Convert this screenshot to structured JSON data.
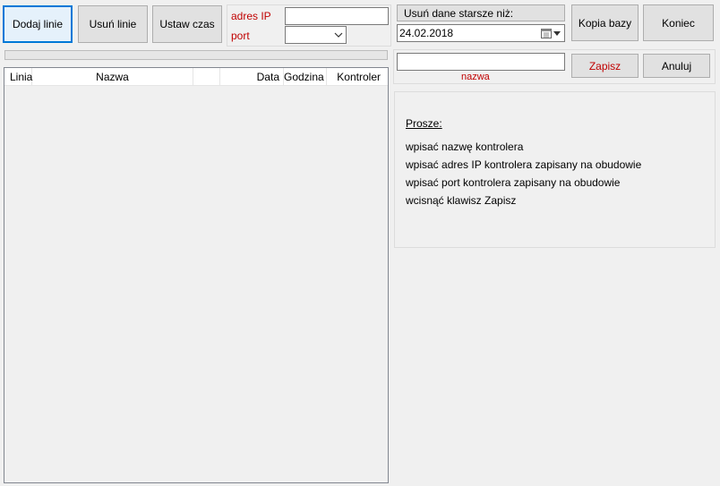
{
  "toolbar": {
    "add_line": "Dodaj linie",
    "remove_line": "Usuń linie",
    "set_time": "Ustaw czas"
  },
  "connection": {
    "ip_label": "adres IP",
    "port_label": "port",
    "ip_value": "",
    "port_value": ""
  },
  "delete_older": {
    "label": "Usuń dane starsze niż:",
    "date": "24.02.2018"
  },
  "actions": {
    "backup": "Kopia bazy",
    "exit": "Koniec",
    "save": "Zapisz",
    "cancel": "Anuluj"
  },
  "name_field": {
    "value": "",
    "label": "nazwa"
  },
  "table": {
    "columns": [
      "Linia",
      "Nazwa",
      "",
      "Data",
      "Godzina",
      "Kontroler"
    ],
    "rows": []
  },
  "instructions": {
    "heading": "Prosze:",
    "lines": [
      "wpisać nazwę kontrolera",
      "wpisać adres IP kontrolera zapisany na obudowie",
      "wpisać port kontrolera zapisany na obudowie",
      "wcisnąć klawisz Zapisz"
    ]
  },
  "colors": {
    "accent": "#0078d7",
    "label_red": "#c00000"
  }
}
